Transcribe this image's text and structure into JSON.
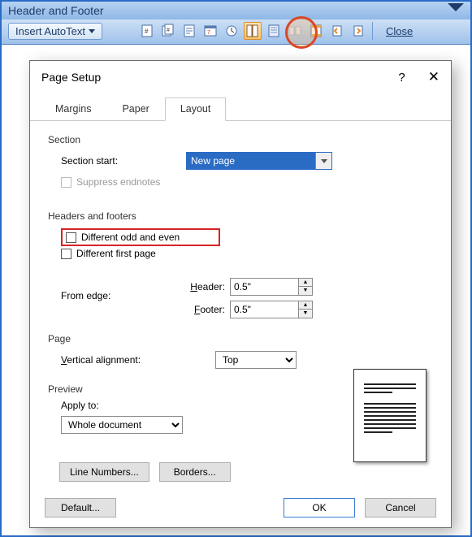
{
  "toolbar": {
    "title": "Header and Footer",
    "autotext": "Insert AutoText",
    "close": "Close",
    "icons": [
      "page-number-icon",
      "num-pages-icon",
      "format-page-num-icon",
      "date-icon",
      "time-icon",
      "page-setup-icon",
      "show-hide-doc-icon",
      "same-as-prev-icon",
      "switch-hf-icon",
      "show-prev-icon",
      "show-next-icon"
    ]
  },
  "dialog": {
    "title": "Page Setup",
    "help": "?",
    "close": "✕",
    "tabs": {
      "margins": "Margins",
      "paper": "Paper",
      "layout": "Layout"
    },
    "section": {
      "legend": "Section",
      "start_label": "Section start:",
      "start_value": "New page",
      "suppress": "Suppress endnotes"
    },
    "hf": {
      "legend": "Headers and footers",
      "odd_even": "Different odd and even",
      "first_page": "Different first page",
      "from_edge": "From edge:",
      "header_label": "Header:",
      "footer_label": "Footer:",
      "header_value": "0.5\"",
      "footer_value": "0.5\""
    },
    "page": {
      "legend": "Page",
      "valign_label": "Vertical alignment:",
      "valign_value": "Top"
    },
    "preview": {
      "legend": "Preview",
      "apply_label": "Apply to:",
      "apply_value": "Whole document"
    },
    "buttons": {
      "line_numbers": "Line Numbers...",
      "borders": "Borders...",
      "default": "Default...",
      "ok": "OK",
      "cancel": "Cancel"
    }
  }
}
